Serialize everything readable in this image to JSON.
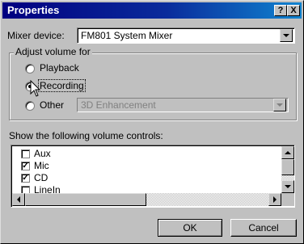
{
  "window": {
    "title": "Properties",
    "help_glyph": "?",
    "close_glyph": "X"
  },
  "mixer": {
    "label": "Mixer device:",
    "value": "FM801 System Mixer"
  },
  "adjust": {
    "legend": "Adjust volume for",
    "options": [
      {
        "label": "Playback",
        "selected": false
      },
      {
        "label": "Recording",
        "selected": true
      },
      {
        "label": "Other",
        "selected": false
      }
    ],
    "other_value": "3D Enhancement"
  },
  "controls": {
    "label": "Show the following volume controls:",
    "items": [
      {
        "label": "Aux",
        "checked": false
      },
      {
        "label": "Mic",
        "checked": true
      },
      {
        "label": "CD",
        "checked": true
      },
      {
        "label": "LineIn",
        "checked": false
      }
    ]
  },
  "buttons": {
    "ok": "OK",
    "cancel": "Cancel"
  }
}
